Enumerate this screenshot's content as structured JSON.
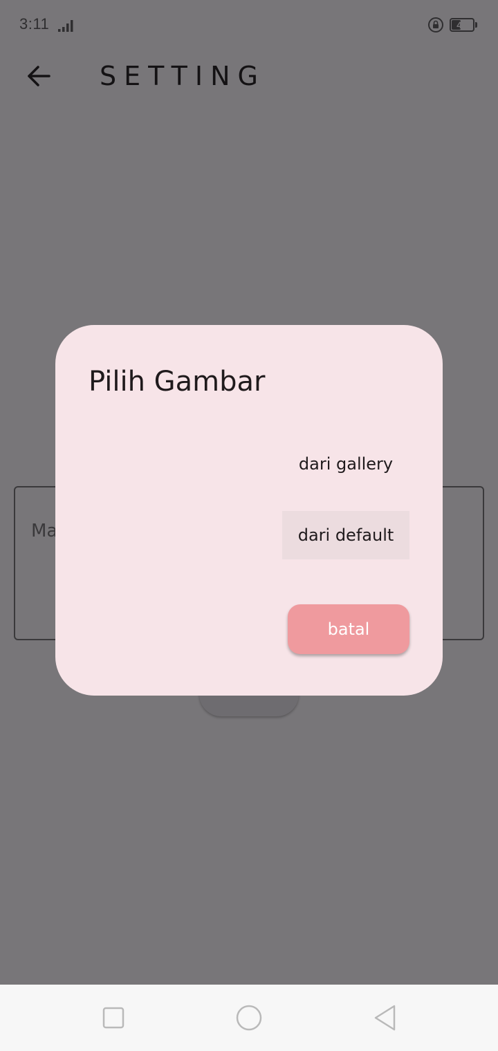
{
  "status_bar": {
    "time": "3:11",
    "battery_level": "42",
    "battery_fraction": 0.42
  },
  "app_bar": {
    "title": "SETTING",
    "back_icon": "arrow-left-icon"
  },
  "background": {
    "field_hint_visible": "Mas"
  },
  "dialog": {
    "title": "Pilih Gambar",
    "options": [
      {
        "label": "dari gallery"
      },
      {
        "label": "dari default"
      }
    ],
    "cancel_label": "batal"
  },
  "colors": {
    "scrim": "#787679",
    "dialog_bg": "#f7e4e8",
    "highlight_option": "#ecdcdf",
    "cancel_button": "#ef9a9e",
    "nav_bar": "#f7f7f7"
  },
  "nav_bar": {
    "icons": [
      "recents-icon",
      "home-icon",
      "back-icon"
    ]
  }
}
